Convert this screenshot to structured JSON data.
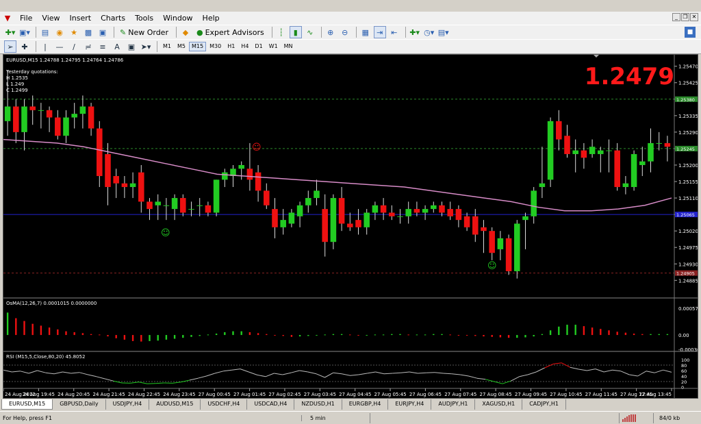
{
  "menu": [
    "File",
    "View",
    "Insert",
    "Charts",
    "Tools",
    "Window",
    "Help"
  ],
  "toolbar": {
    "new_order": "New Order",
    "expert_advisors": "Expert Advisors",
    "timeframes": [
      "M1",
      "M5",
      "M15",
      "M30",
      "H1",
      "H4",
      "D1",
      "W1",
      "MN"
    ],
    "active_timeframe": "M15"
  },
  "chart": {
    "symbol_line": "EURUSD,M15  1.24788 1.24795 1.24764 1.24786",
    "yesterday_title": "Yesterday quotations:",
    "yesterday_high": "H 1.2535",
    "yesterday_low": "L 1.249",
    "yesterday_close": "C 1.2499",
    "big_price": "1.2479",
    "big_price_color": "#ff1a1a",
    "price_axis": [
      "1.25470",
      "1.25425",
      "1.25380",
      "1.25335",
      "1.25290",
      "1.25245",
      "1.25200",
      "1.25155",
      "1.25110",
      "1.25065",
      "1.25020",
      "1.24975",
      "1.24930",
      "1.24885"
    ],
    "level_labels": [
      "1.25380",
      "1.25245",
      "1.25065",
      "1.24905"
    ],
    "osma_label": "OsMA(12,26,7) 0.0001015 0.0000000",
    "osma_axis": [
      "0.000573",
      "0.00",
      "-0.000307"
    ],
    "rsi_label": "RSI (M15,5,Close,80,20) 45.8052",
    "rsi_axis": [
      "100",
      "80",
      "60",
      "40",
      "20",
      "0"
    ],
    "time_axis": [
      "24 Aug 2012",
      "24 Aug 19:45",
      "24 Aug 20:45",
      "24 Aug 21:45",
      "24 Aug 22:45",
      "24 Aug 23:45",
      "27 Aug 00:45",
      "27 Aug 01:45",
      "27 Aug 02:45",
      "27 Aug 03:45",
      "27 Aug 04:45",
      "27 Aug 05:45",
      "27 Aug 06:45",
      "27 Aug 07:45",
      "27 Aug 08:45",
      "27 Aug 09:45",
      "27 Aug 10:45",
      "27 Aug 11:45",
      "27 Aug 12:45",
      "27 Aug 13:45"
    ],
    "bull_color": "#22cc22",
    "bear_color": "#ee1111",
    "ma_color": "#d88cc8"
  },
  "chart_data": [
    {
      "type": "candlestick",
      "title": "EURUSD,M15",
      "ylim": [
        1.24865,
        1.2549
      ],
      "candles": [
        [
          1.2532,
          1.2546,
          1.2528,
          1.2536
        ],
        [
          1.2536,
          1.2538,
          1.2526,
          1.2529
        ],
        [
          1.2529,
          1.2538,
          1.2524,
          1.2536
        ],
        [
          1.2536,
          1.2539,
          1.2531,
          1.2535
        ],
        [
          1.2535,
          1.2537,
          1.253,
          1.2535
        ],
        [
          1.2535,
          1.2536,
          1.2529,
          1.2533
        ],
        [
          1.2533,
          1.2535,
          1.2527,
          1.2528
        ],
        [
          1.2528,
          1.2535,
          1.2526,
          1.2533
        ],
        [
          1.2533,
          1.2537,
          1.253,
          1.2534
        ],
        [
          1.2534,
          1.2539,
          1.253,
          1.2536
        ],
        [
          1.2536,
          1.2537,
          1.2528,
          1.253
        ],
        [
          1.253,
          1.2532,
          1.2514,
          1.2517
        ],
        [
          1.2523,
          1.2526,
          1.2509,
          1.2514
        ],
        [
          1.2517,
          1.2519,
          1.2511,
          1.2515
        ],
        [
          1.2515,
          1.2517,
          1.2511,
          1.2514
        ],
        [
          1.2514,
          1.2518,
          1.2511,
          1.2515
        ],
        [
          1.2518,
          1.252,
          1.2507,
          1.251
        ],
        [
          1.251,
          1.2511,
          1.2505,
          1.2508
        ],
        [
          1.2509,
          1.2512,
          1.2505,
          1.251
        ],
        [
          1.2509,
          1.2511,
          1.2505,
          1.2509
        ],
        [
          1.2508,
          1.2512,
          1.2505,
          1.2511
        ],
        [
          1.2511,
          1.2512,
          1.2506,
          1.2507
        ],
        [
          1.2508,
          1.251,
          1.2506,
          1.2508
        ],
        [
          1.2509,
          1.2511,
          1.2506,
          1.2509
        ],
        [
          1.2509,
          1.251,
          1.2506,
          1.2507
        ],
        [
          1.2507,
          1.2516,
          1.2506,
          1.2516
        ],
        [
          1.2516,
          1.2519,
          1.2514,
          1.2518
        ],
        [
          1.2517,
          1.252,
          1.2514,
          1.2519
        ],
        [
          1.2519,
          1.2521,
          1.2516,
          1.252
        ],
        [
          1.2519,
          1.2526,
          1.2513,
          1.2516
        ],
        [
          1.2518,
          1.252,
          1.251,
          1.2513
        ],
        [
          1.2513,
          1.2515,
          1.2508,
          1.2509
        ],
        [
          1.2508,
          1.2511,
          1.25,
          1.2503
        ],
        [
          1.2503,
          1.2508,
          1.2501,
          1.2505
        ],
        [
          1.2504,
          1.2508,
          1.2503,
          1.2507
        ],
        [
          1.2506,
          1.251,
          1.2503,
          1.2509
        ],
        [
          1.2509,
          1.2513,
          1.2507,
          1.2511
        ],
        [
          1.2511,
          1.2516,
          1.2509,
          1.2513
        ],
        [
          1.2508,
          1.2512,
          1.2495,
          1.2499
        ],
        [
          1.2499,
          1.2512,
          1.2497,
          1.2511
        ],
        [
          1.2511,
          1.2514,
          1.2502,
          1.2504
        ],
        [
          1.2504,
          1.2507,
          1.2502,
          1.2503
        ],
        [
          1.2505,
          1.2508,
          1.2501,
          1.2503
        ],
        [
          1.2503,
          1.2508,
          1.2501,
          1.2507
        ],
        [
          1.2507,
          1.251,
          1.2505,
          1.2509
        ],
        [
          1.2509,
          1.2511,
          1.2505,
          1.2507
        ],
        [
          1.2507,
          1.2509,
          1.2505,
          1.2506
        ],
        [
          1.2506,
          1.2508,
          1.2504,
          1.2506
        ],
        [
          1.2506,
          1.251,
          1.2504,
          1.2508
        ],
        [
          1.2508,
          1.251,
          1.2506,
          1.2507
        ],
        [
          1.2507,
          1.2509,
          1.2505,
          1.2508
        ],
        [
          1.2508,
          1.251,
          1.2507,
          1.2509
        ],
        [
          1.2509,
          1.251,
          1.2506,
          1.2507
        ],
        [
          1.2508,
          1.251,
          1.2505,
          1.2506
        ],
        [
          1.2508,
          1.2509,
          1.2503,
          1.2505
        ],
        [
          1.2506,
          1.2507,
          1.2502,
          1.2503
        ],
        [
          1.2506,
          1.2508,
          1.2499,
          1.2501
        ],
        [
          1.2503,
          1.2505,
          1.2496,
          1.2502
        ],
        [
          1.2502,
          1.2503,
          1.2494,
          1.2496
        ],
        [
          1.2497,
          1.2502,
          1.2494,
          1.25
        ],
        [
          1.25,
          1.2501,
          1.249,
          1.2491
        ],
        [
          1.2491,
          1.2505,
          1.2489,
          1.2504
        ],
        [
          1.2505,
          1.2507,
          1.2497,
          1.2506
        ],
        [
          1.2506,
          1.2514,
          1.2504,
          1.2513
        ],
        [
          1.2514,
          1.2525,
          1.2511,
          1.2515
        ],
        [
          1.2516,
          1.2533,
          1.2514,
          1.2532
        ],
        [
          1.2532,
          1.2535,
          1.2524,
          1.2527
        ],
        [
          1.2528,
          1.2531,
          1.2522,
          1.2523
        ],
        [
          1.2523,
          1.2527,
          1.2518,
          1.2524
        ],
        [
          1.2524,
          1.2526,
          1.2519,
          1.2522
        ],
        [
          1.2523,
          1.2527,
          1.2522,
          1.2525
        ],
        [
          1.2523,
          1.2525,
          1.2518,
          1.2524
        ],
        [
          1.2524,
          1.2527,
          1.2518,
          1.2524
        ],
        [
          1.2524,
          1.2526,
          1.2513,
          1.2514
        ],
        [
          1.2514,
          1.2517,
          1.2512,
          1.2515
        ],
        [
          1.2514,
          1.2524,
          1.2513,
          1.2523
        ],
        [
          1.252,
          1.2525,
          1.2517,
          1.2521
        ],
        [
          1.2521,
          1.253,
          1.2518,
          1.2526
        ],
        [
          1.2526,
          1.2529,
          1.2524,
          1.2526
        ],
        [
          1.2526,
          1.2528,
          1.2521,
          1.2525
        ]
      ],
      "moving_average": [
        1.2527,
        1.25265,
        1.2526,
        1.2525,
        1.25235,
        1.2522,
        1.25205,
        1.2519,
        1.25175,
        1.2517,
        1.25165,
        1.2516,
        1.25155,
        1.2515,
        1.25145,
        1.2514,
        1.2513,
        1.2512,
        1.2511,
        1.251,
        1.25085,
        1.25075,
        1.25075,
        1.2508,
        1.2509,
        1.2511
      ],
      "horizontal_lines": [
        {
          "value": 1.2538,
          "style": "dashed",
          "color": "#2a8a2a"
        },
        {
          "value": 1.25245,
          "style": "dashed",
          "color": "#2a8a2a"
        },
        {
          "value": 1.25065,
          "style": "solid",
          "color": "#2222cc"
        },
        {
          "value": 1.24905,
          "style": "dashed",
          "color": "#8a2222"
        }
      ]
    },
    {
      "type": "bar",
      "title": "OsMA(12,26,7)",
      "ylim": [
        -0.000307,
        0.000573
      ],
      "values": [
        0.00048,
        0.00036,
        0.0003,
        0.00024,
        0.0002,
        0.00016,
        0.00012,
        8e-05,
        6e-05,
        4e-05,
        2e-05,
        1e-05,
        -3e-05,
        -7e-05,
        -0.0001,
        -0.00013,
        -0.00014,
        -0.00013,
        -0.00012,
        -0.0001,
        -8e-05,
        -6e-05,
        -4e-05,
        -2e-05,
        1e-05,
        3e-05,
        6e-05,
        8e-05,
        8e-05,
        6e-05,
        4e-05,
        2e-05,
        0.0,
        -2e-05,
        -4e-05,
        -3e-05,
        -2e-05,
        -1e-05,
        1e-05,
        2e-05,
        2e-05,
        1e-05,
        0.0,
        0.0,
        1e-05,
        1e-05,
        2e-05,
        2e-05,
        1e-05,
        1e-05,
        1e-05,
        2e-05,
        2e-05,
        1e-05,
        0.0,
        -1e-05,
        -2e-05,
        -3e-05,
        -4e-05,
        -5e-05,
        -6e-05,
        -6e-05,
        -5e-05,
        -3e-05,
        2e-05,
        0.0001,
        0.00018,
        0.00022,
        0.00022,
        0.00019,
        0.00016,
        0.00013,
        0.0001,
        7e-05,
        5e-05,
        3e-05,
        2e-05,
        2e-05,
        2e-05,
        2e-05
      ]
    },
    {
      "type": "line",
      "title": "RSI (M15,5,Close,80,20)",
      "ylim": [
        0,
        100
      ],
      "levels": [
        80,
        20
      ],
      "values": [
        62,
        55,
        58,
        50,
        60,
        52,
        48,
        55,
        50,
        53,
        45,
        38,
        30,
        22,
        15,
        14,
        18,
        12,
        13,
        15,
        14,
        18,
        25,
        32,
        40,
        50,
        58,
        62,
        66,
        55,
        44,
        38,
        50,
        45,
        52,
        60,
        55,
        48,
        35,
        52,
        48,
        42,
        45,
        50,
        55,
        48,
        50,
        52,
        55,
        50,
        52,
        53,
        50,
        48,
        45,
        40,
        32,
        28,
        20,
        12,
        22,
        38,
        45,
        55,
        70,
        84,
        88,
        72,
        65,
        60,
        66,
        55,
        62,
        58,
        45,
        40,
        58,
        52,
        62,
        54
      ]
    }
  ],
  "tabs": [
    "EURUSD,M15",
    "GBPUSD,Daily",
    "USDJPY,H4",
    "AUDUSD,M15",
    "USDCHF,H4",
    "USDCAD,H4",
    "NZDUSD,H1",
    "EURGBP,H4",
    "EURJPY,H4",
    "AUDJPY,H1",
    "XAGUSD,H1",
    "CADJPY,H1"
  ],
  "active_tab": 0,
  "status": {
    "help": "For Help, press F1",
    "timeframe": "5 min",
    "traffic": "84/0 kb"
  }
}
